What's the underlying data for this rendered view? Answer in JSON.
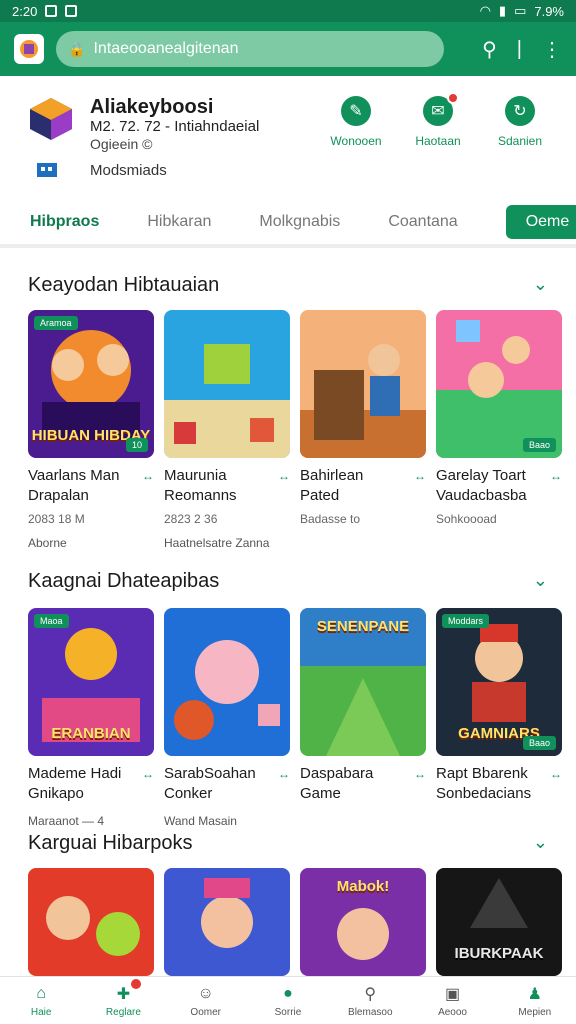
{
  "status_bar": {
    "time": "2:20",
    "right_text": "7.9%"
  },
  "top_bar": {
    "search_text": "Intaeooanealgitenan"
  },
  "app": {
    "title": "Aliakeyboosi",
    "subtitle": "M2. 72. 72 - Intiahndaeial",
    "meta": "Ogieein ©",
    "developer": "Modsmiads"
  },
  "actions": [
    {
      "label": "Wonooen",
      "icon": "leaf-icon"
    },
    {
      "label": "Haotaan",
      "icon": "chat-icon"
    },
    {
      "label": "Sdanien",
      "icon": "refresh-icon"
    }
  ],
  "tabs": [
    {
      "label": "Hibpraos"
    },
    {
      "label": "Hibkaran"
    },
    {
      "label": "Molkgnabis"
    },
    {
      "label": "Coantana"
    }
  ],
  "tab_button": "Oeme",
  "sections": [
    {
      "title": "Keayodan Hibtauaian",
      "cards": [
        {
          "name1": "Vaarlans Man",
          "name2": "Drapalan",
          "meta": "2083 18 M",
          "sub": "Aborne",
          "tag": "Aramoa",
          "caption": "HIBUAN HIBDAY",
          "tagb": "10"
        },
        {
          "name1": "Maurunia",
          "name2": "Reomanns",
          "meta": "2823 2 36",
          "sub": "Haatnelsatre Zanna",
          "tag": "",
          "caption": "",
          "tagb": ""
        },
        {
          "name1": "Bahirlean",
          "name2": "Pated",
          "meta": "Badasse to",
          "sub": "",
          "tag": "",
          "caption": "",
          "tagb": ""
        },
        {
          "name1": "Garelay Toart",
          "name2": "Vaudacbasba",
          "meta": "Sohkoooad",
          "sub": "",
          "tag": "",
          "caption": "",
          "tagb": "Baao"
        }
      ]
    },
    {
      "title": "Kaagnai Dhateapibas",
      "cards": [
        {
          "name1": "Mademe Hadi",
          "name2": "Gnikapo",
          "meta": "",
          "sub": "Maraanot — 4",
          "tag": "Maoa",
          "caption": "ERANBIAN",
          "tagb": ""
        },
        {
          "name1": "SarabSoahan",
          "name2": "Conker",
          "meta": "",
          "sub": "Wand Masain",
          "tag": "",
          "caption": "",
          "tagb": ""
        },
        {
          "name1": "Daspabara",
          "name2": "Game",
          "meta": "",
          "sub": "",
          "tag": "",
          "caption": "SENENPANE",
          "tagb": ""
        },
        {
          "name1": "Rapt Bbarenk",
          "name2": "Sonbedacians",
          "meta": "",
          "sub": "",
          "tag": "Moddars",
          "caption": "GAMNIARS",
          "tagb": "Baao"
        }
      ]
    },
    {
      "title": "Karguai Hibarpoks",
      "cards": [
        {
          "name1": "",
          "name2": "",
          "meta": "",
          "sub": "",
          "tag": "",
          "caption": "",
          "tagb": ""
        },
        {
          "name1": "",
          "name2": "",
          "meta": "",
          "sub": "",
          "tag": "",
          "caption": "",
          "tagb": ""
        },
        {
          "name1": "",
          "name2": "",
          "meta": "",
          "sub": "",
          "tag": "",
          "caption": "Mabok!",
          "tagb": ""
        },
        {
          "name1": "",
          "name2": "",
          "meta": "",
          "sub": "",
          "tag": "",
          "caption": "IBURKPAAK",
          "tagb": ""
        }
      ]
    }
  ],
  "bottom_nav": [
    {
      "label": "Haie",
      "icon": "home-icon"
    },
    {
      "label": "Reglare",
      "icon": "add-icon"
    },
    {
      "label": "Oomer",
      "icon": "face-icon"
    },
    {
      "label": "Sorrie",
      "icon": "smile-icon"
    },
    {
      "label": "Blemasoo",
      "icon": "search-icon"
    },
    {
      "label": "Aeooo",
      "icon": "gamepad-icon"
    },
    {
      "label": "Mepien",
      "icon": "person-icon"
    }
  ],
  "colors": {
    "brand": "#10905a",
    "brand_dark": "#0f7a4e",
    "badge": "#e53935"
  }
}
